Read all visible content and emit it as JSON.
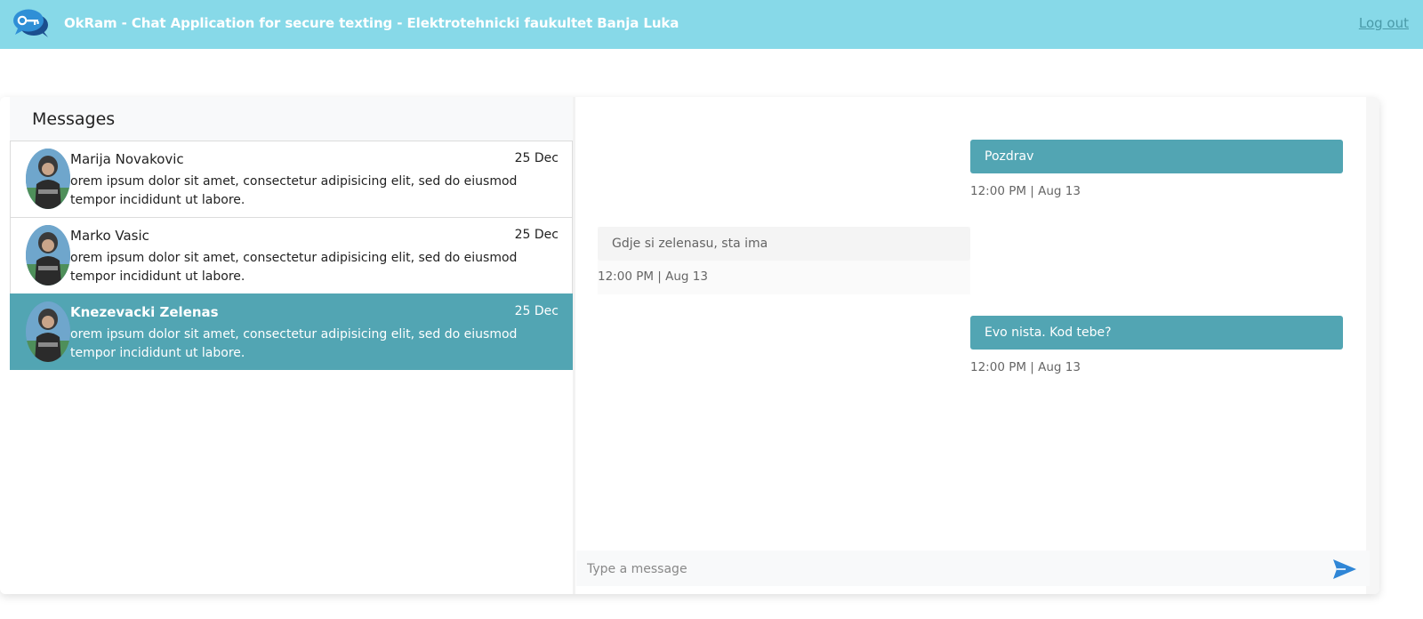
{
  "header": {
    "title": "OkRam - Chat Application for secure texting - Elektrotehnicki faukultet Banja Luka",
    "logout_label": "Log out"
  },
  "inbox": {
    "title": "Messages",
    "chats": [
      {
        "name": "Marija Novakovic",
        "date": "25 Dec",
        "preview": "orem ipsum dolor sit amet, consectetur adipisicing elit, sed do eiusmod tempor incididunt ut labore.",
        "active": false
      },
      {
        "name": "Marko Vasic",
        "date": "25 Dec",
        "preview": "orem ipsum dolor sit amet, consectetur adipisicing elit, sed do eiusmod tempor incididunt ut labore.",
        "active": false
      },
      {
        "name": "Knezevacki Zelenas",
        "date": "25 Dec",
        "preview": "orem ipsum dolor sit amet, consectetur adipisicing elit, sed do eiusmod tempor incididunt ut labore.",
        "active": true
      }
    ]
  },
  "conversation": {
    "messages": [
      {
        "direction": "outgoing",
        "text": "Pozdrav",
        "time": "12:00 PM | Aug 13"
      },
      {
        "direction": "incoming",
        "text": "Gdje si zelenasu, sta ima",
        "time": "12:00 PM | Aug 13"
      },
      {
        "direction": "outgoing",
        "text": "Evo nista. Kod tebe?",
        "time": "12:00 PM | Aug 13"
      }
    ]
  },
  "composer": {
    "placeholder": "Type a message",
    "send_icon": "send-icon"
  },
  "colors": {
    "navbar": "#87d9e8",
    "accent": "#52a5b3",
    "logout_link": "#4a9aa8"
  }
}
